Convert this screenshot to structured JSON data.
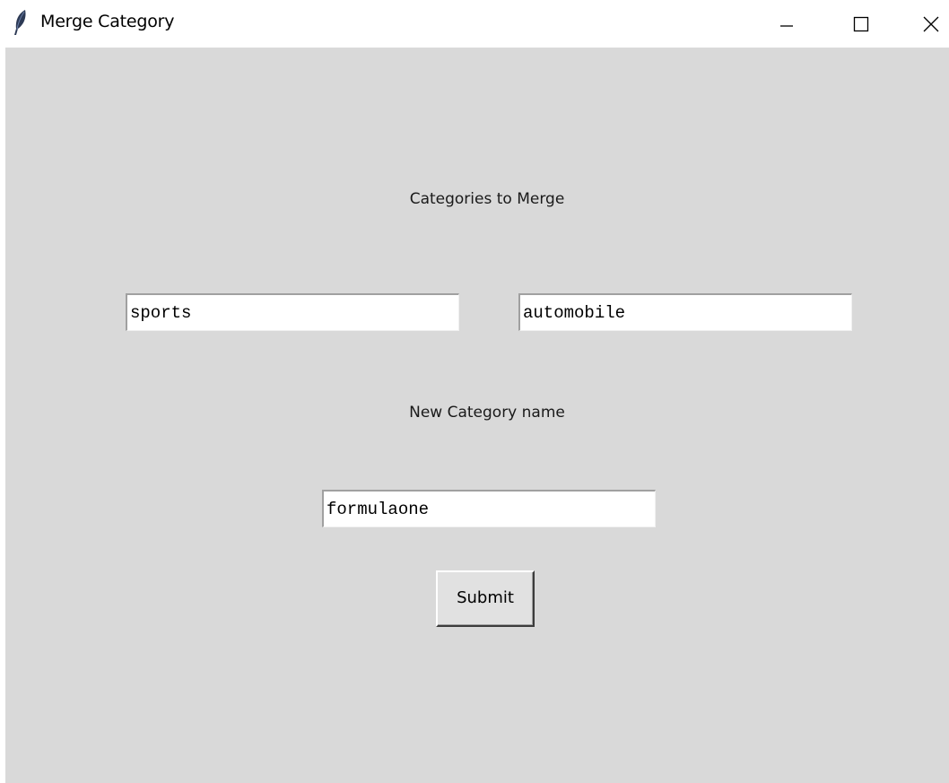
{
  "window": {
    "title": "Merge Category",
    "icon": "feather-icon",
    "controls": [
      "minimize-icon",
      "maximize-icon",
      "close-icon"
    ]
  },
  "form": {
    "merge_label": "Categories to Merge",
    "category_one_value": "sports",
    "category_two_value": "automobile",
    "new_name_label": "New Category name",
    "new_name_value": "formulaone",
    "submit_label": "Submit"
  },
  "colors": {
    "client_background": "#d9d9d9",
    "titlebar_background": "#ffffff",
    "entry_background": "#ffffff"
  }
}
